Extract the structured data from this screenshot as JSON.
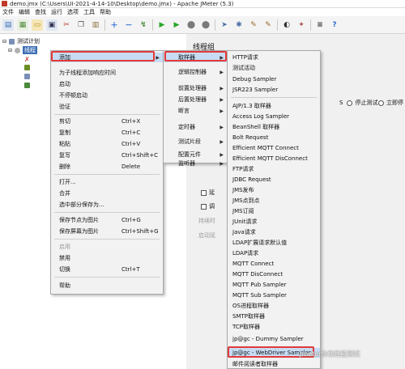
{
  "window": {
    "title": "demo.jmx (C:\\Users\\UI-2021-4-14-10\\Desktop\\demo.jmx) - Apache JMeter (5.3)"
  },
  "menubar": [
    "文件",
    "编辑",
    "查找",
    "运行",
    "选项",
    "工具",
    "帮助"
  ],
  "tree": {
    "root_label": "测试计划",
    "selected_label": "线程"
  },
  "right_panel": {
    "title": "线程组",
    "radio_stop_test": "停止测试",
    "radio_stop_now": "立即停",
    "checkbox_delay": "延",
    "checkbox_schedule": "调",
    "duration_label": "持续时",
    "startup_delay_label": "启动延",
    "letter_S": "S"
  },
  "context_menu": {
    "items": [
      {
        "label": "添加",
        "shortcut": ""
      },
      {
        "label": "为子线程添加响应时间",
        "shortcut": ""
      },
      {
        "label": "启动",
        "shortcut": ""
      },
      {
        "label": "不停顿启动",
        "shortcut": ""
      },
      {
        "label": "验证",
        "shortcut": ""
      },
      {
        "label": "剪切",
        "shortcut": "Ctrl+X"
      },
      {
        "label": "复制",
        "shortcut": "Ctrl+C"
      },
      {
        "label": "粘贴",
        "shortcut": "Ctrl+V"
      },
      {
        "label": "复写",
        "shortcut": "Ctrl+Shift+C"
      },
      {
        "label": "删除",
        "shortcut": "Delete"
      },
      {
        "label": "打开...",
        "shortcut": ""
      },
      {
        "label": "合并",
        "shortcut": ""
      },
      {
        "label": "选中部分保存为...",
        "shortcut": ""
      },
      {
        "label": "保存节点为图片",
        "shortcut": "Ctrl+G"
      },
      {
        "label": "保存屏幕为图片",
        "shortcut": "Ctrl+Shift+G"
      },
      {
        "label": "启用",
        "shortcut": ""
      },
      {
        "label": "禁用",
        "shortcut": ""
      },
      {
        "label": "切换",
        "shortcut": "Ctrl+T"
      },
      {
        "label": "帮助",
        "shortcut": ""
      }
    ]
  },
  "add_submenu": {
    "items": [
      "取样器",
      "逻辑控制器",
      "前置处理器",
      "后置处理器",
      "断言",
      "定时器",
      "测试片段",
      "配置元件",
      "监听器"
    ]
  },
  "sampler_submenu": {
    "items": [
      "HTTP请求",
      "测试活动",
      "Debug Sampler",
      "JSR223 Sampler",
      "AJP/1.3 取样器",
      "Access Log Sampler",
      "BeanShell 取样器",
      "Bolt Request",
      "Efficient MQTT Connect",
      "Efficient MQTT DisConnect",
      "FTP请求",
      "JDBC Request",
      "JMS发布",
      "JMS点到点",
      "JMS订阅",
      "JUnit请求",
      "Java请求",
      "LDAP扩展请求默认值",
      "LDAP请求",
      "MQTT Connect",
      "MQTT DisConnect",
      "MQTT Pub Sampler",
      "MQTT Sub Sampler",
      "OS进程取样器",
      "SMTP取样器",
      "TCP取样器",
      "jp@gc - Dummy Sampler",
      "jp@gc - WebDriver Sampler",
      "邮件阅读者取样器"
    ]
  },
  "watermark": "Jmeter全栈性能测试",
  "colors": {
    "highlight": "#c7dcf3",
    "annotation_red": "#e23a3a"
  }
}
